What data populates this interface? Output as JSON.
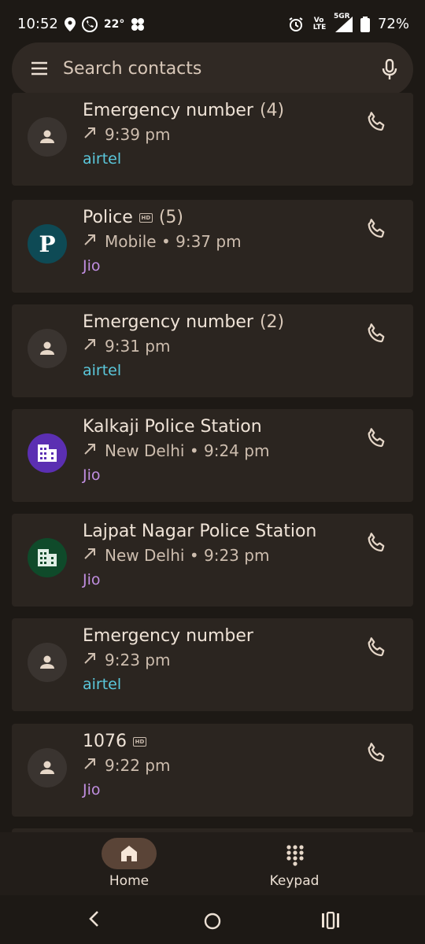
{
  "status_bar": {
    "time": "10:52",
    "temperature": "22°",
    "battery": "72%",
    "volte": "Vo LTE",
    "network": "5GR"
  },
  "search": {
    "placeholder": "Search contacts",
    "menu_icon": "hamburger-menu-icon",
    "mic_icon": "microphone-icon"
  },
  "calls": [
    {
      "name": "Emergency number",
      "count": "(4)",
      "hd": false,
      "detail": "9:39 pm",
      "sim": "airtel",
      "avatar": "person"
    },
    {
      "name": "Police",
      "count": "(5)",
      "hd": true,
      "detail": "Mobile • 9:37 pm",
      "sim": "Jio",
      "avatar": "letter",
      "letter": "P"
    },
    {
      "name": "Emergency number",
      "count": "(2)",
      "hd": false,
      "detail": "9:31 pm",
      "sim": "airtel",
      "avatar": "person"
    },
    {
      "name": "Kalkaji Police Station",
      "count": "",
      "hd": false,
      "detail": "New Delhi • 9:24 pm",
      "sim": "Jio",
      "avatar": "business-purple"
    },
    {
      "name": "Lajpat Nagar Police Station",
      "count": "",
      "hd": false,
      "detail": "New Delhi • 9:23 pm",
      "sim": "Jio",
      "avatar": "business-green"
    },
    {
      "name": "Emergency number",
      "count": "",
      "hd": false,
      "detail": "9:23 pm",
      "sim": "airtel",
      "avatar": "person"
    },
    {
      "name": "1076",
      "count": "",
      "hd": true,
      "detail": "9:22 pm",
      "sim": "Jio",
      "avatar": "person"
    }
  ],
  "hd_badge": "HD",
  "bottom_nav": {
    "home_label": "Home",
    "keypad_label": "Keypad"
  },
  "colors": {
    "background": "#1d1915",
    "card": "#2b2520",
    "airtel": "#5bc8dc",
    "jio": "#c08ee0",
    "home_active_pill": "#5a4437"
  }
}
